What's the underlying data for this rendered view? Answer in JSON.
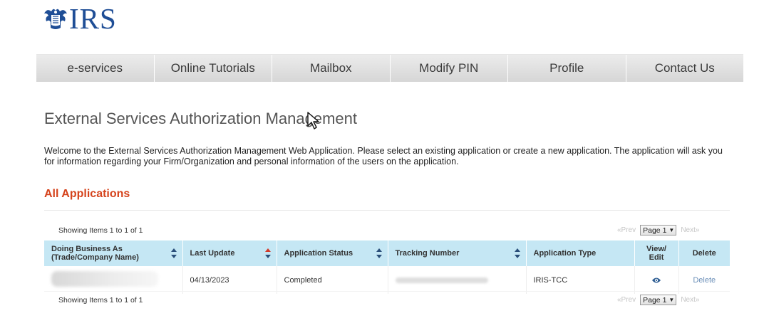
{
  "header": {
    "logo_text": "IRS",
    "logo_icon": "eagle-emblem-icon"
  },
  "nav": {
    "items": [
      {
        "label": "e-services"
      },
      {
        "label": "Online Tutorials"
      },
      {
        "label": "Mailbox"
      },
      {
        "label": "Modify PIN"
      },
      {
        "label": "Profile"
      },
      {
        "label": "Contact Us"
      }
    ]
  },
  "main": {
    "title": "External Services Authorization Management",
    "intro": "Welcome to the External Services Authorization Management Web Application. Please select an existing application or create a new application. The application will ask you for information regarding your Firm/Organization and personal information of the users on the application.",
    "section_title": "All Applications"
  },
  "table": {
    "showing_top": "Showing Items 1 to 1 of 1",
    "showing_bottom": "Showing Items 1 to 1 of 1",
    "pager": {
      "prev": "«Prev",
      "page": "Page 1",
      "next": "Next»"
    },
    "columns": [
      {
        "label": "Doing Business As (Trade/Company Name)",
        "sortable": true
      },
      {
        "label": "Last Update",
        "sortable": true
      },
      {
        "label": "Application Status",
        "sortable": true
      },
      {
        "label": "Tracking Number",
        "sortable": true
      },
      {
        "label": "Application Type",
        "sortable": false
      },
      {
        "label": "View/ Edit",
        "sortable": false
      },
      {
        "label": "Delete",
        "sortable": false
      }
    ],
    "rows": [
      {
        "last_update": "04/13/2023",
        "status": "Completed",
        "application_type": "IRIS-TCC",
        "view_icon": "eye-icon",
        "delete_label": "Delete"
      }
    ]
  },
  "colors": {
    "brand_blue": "#1f4e96",
    "section_title": "#d5431c",
    "table_header_bg": "#c5e7f4",
    "link": "#6b8fb8"
  }
}
